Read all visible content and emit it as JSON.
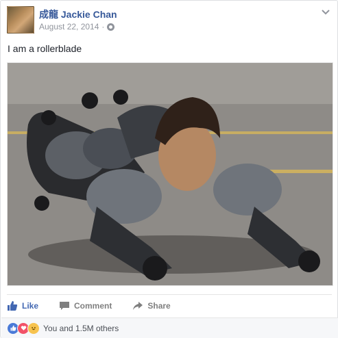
{
  "post": {
    "author": "成龍 Jackie Chan",
    "date": "August 22, 2014",
    "separator": "·",
    "privacy_icon": "globe-icon",
    "menu_icon": "chevron-down-icon",
    "text": "I am a rollerblade"
  },
  "actions": {
    "like_label": "Like",
    "comment_label": "Comment",
    "share_label": "Share"
  },
  "reactions": {
    "summary": "You and 1.5M others",
    "types": [
      "like",
      "love",
      "haha"
    ]
  },
  "colors": {
    "link_blue": "#365899",
    "like_blue": "#4267b2",
    "meta_gray": "#90949c",
    "footer_bg": "#f6f7f9"
  }
}
